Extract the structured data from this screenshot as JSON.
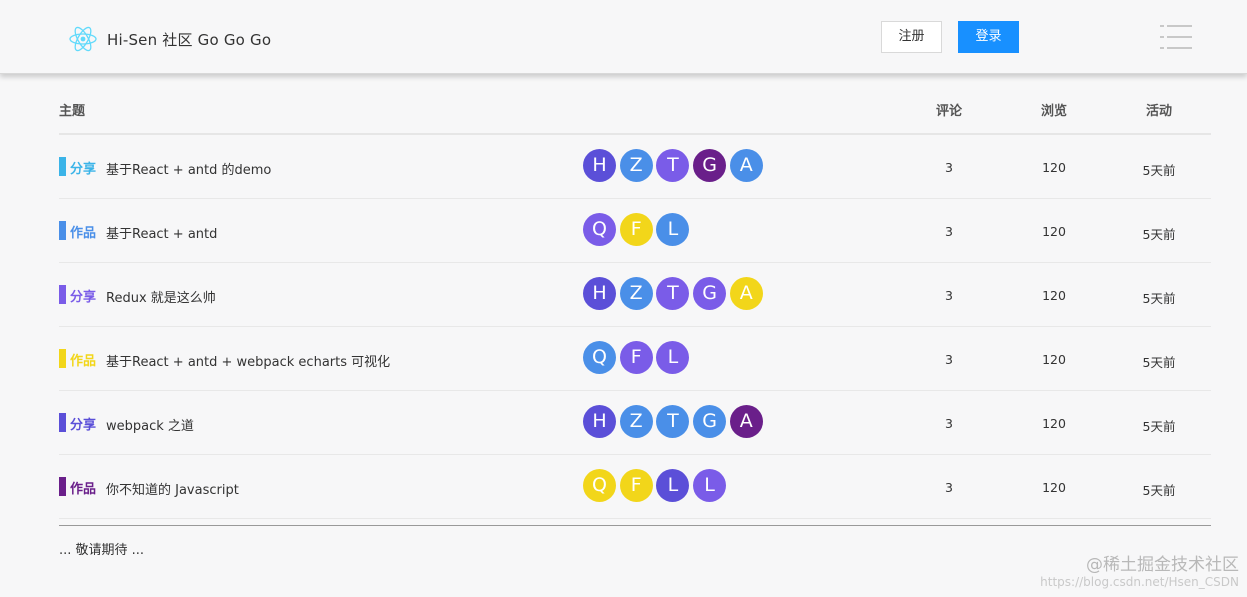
{
  "header": {
    "brand": "Hi-Sen 社区 Go Go Go",
    "register_label": "注册",
    "login_label": "登录",
    "logo_icon": "react-atom-icon",
    "menu_icon": "list-menu-icon"
  },
  "table": {
    "columns": {
      "topic": "主题",
      "comments": "评论",
      "views": "浏览",
      "activity": "活动"
    },
    "rows": [
      {
        "tag": "分享",
        "tag_color": "#3bb4e8",
        "title": "基于React + antd 的demo",
        "avatars": [
          {
            "letter": "H",
            "color": "#5b4fd8"
          },
          {
            "letter": "Z",
            "color": "#4a8fe8"
          },
          {
            "letter": "T",
            "color": "#7a5ce8"
          },
          {
            "letter": "G",
            "color": "#6a1f8a"
          },
          {
            "letter": "A",
            "color": "#4a8fe8"
          }
        ],
        "comments": "3",
        "views": "120",
        "activity": "5天前"
      },
      {
        "tag": "作品",
        "tag_color": "#4a8fe8",
        "title": "基于React + antd",
        "avatars": [
          {
            "letter": "Q",
            "color": "#7a5ce8"
          },
          {
            "letter": "F",
            "color": "#f2d61a"
          },
          {
            "letter": "L",
            "color": "#4a8fe8"
          }
        ],
        "comments": "3",
        "views": "120",
        "activity": "5天前"
      },
      {
        "tag": "分享",
        "tag_color": "#7a5ce8",
        "title": "Redux 就是这么帅",
        "avatars": [
          {
            "letter": "H",
            "color": "#5b4fd8"
          },
          {
            "letter": "Z",
            "color": "#4a8fe8"
          },
          {
            "letter": "T",
            "color": "#7a5ce8"
          },
          {
            "letter": "G",
            "color": "#7a5ce8"
          },
          {
            "letter": "A",
            "color": "#f2d61a"
          }
        ],
        "comments": "3",
        "views": "120",
        "activity": "5天前"
      },
      {
        "tag": "作品",
        "tag_color": "#f2d61a",
        "title": "基于React + antd + webpack echarts 可视化",
        "avatars": [
          {
            "letter": "Q",
            "color": "#4a8fe8"
          },
          {
            "letter": "F",
            "color": "#7a5ce8"
          },
          {
            "letter": "L",
            "color": "#7a5ce8"
          }
        ],
        "comments": "3",
        "views": "120",
        "activity": "5天前"
      },
      {
        "tag": "分享",
        "tag_color": "#5b4fd8",
        "title": "webpack 之道",
        "avatars": [
          {
            "letter": "H",
            "color": "#5b4fd8"
          },
          {
            "letter": "Z",
            "color": "#4a8fe8"
          },
          {
            "letter": "T",
            "color": "#4a8fe8"
          },
          {
            "letter": "G",
            "color": "#4a8fe8"
          },
          {
            "letter": "A",
            "color": "#6a1f8a"
          }
        ],
        "comments": "3",
        "views": "120",
        "activity": "5天前"
      },
      {
        "tag": "作品",
        "tag_color": "#6a1f8a",
        "title": "你不知道的 Javascript",
        "avatars": [
          {
            "letter": "Q",
            "color": "#f2d61a"
          },
          {
            "letter": "F",
            "color": "#f2d61a"
          },
          {
            "letter": "L",
            "color": "#5b4fd8"
          },
          {
            "letter": "L",
            "color": "#7a5ce8"
          }
        ],
        "comments": "3",
        "views": "120",
        "activity": "5天前"
      }
    ]
  },
  "footer": {
    "more": "... 敬请期待 ..."
  },
  "watermark": {
    "main": "@稀土掘金技术社区",
    "sub": "https://blog.csdn.net/Hsen_CSDN"
  }
}
